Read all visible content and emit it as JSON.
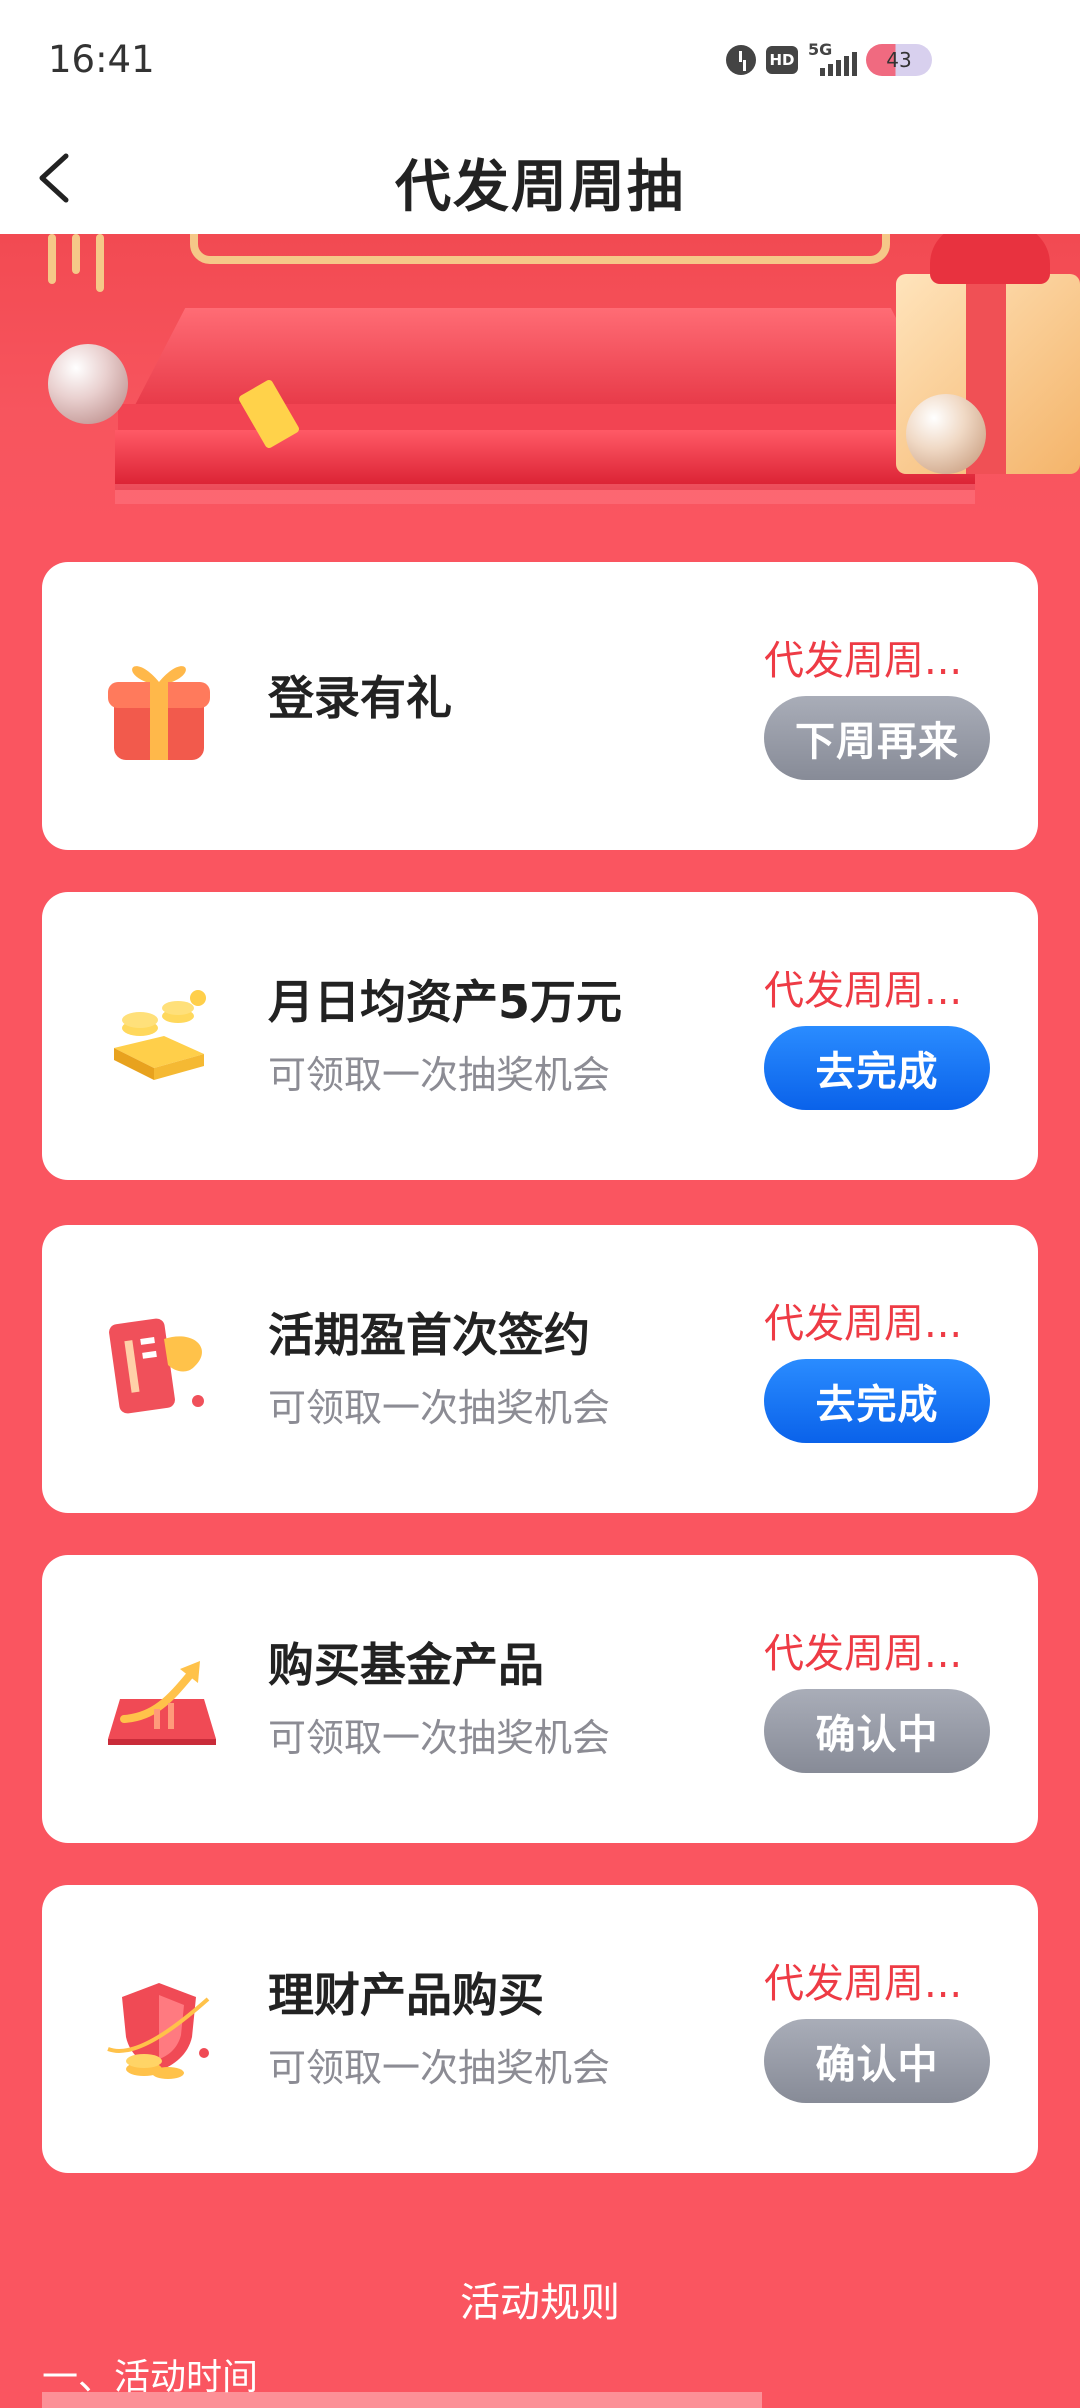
{
  "status_bar": {
    "time": "16:41",
    "hd_label": "HD",
    "network_label": "5G",
    "battery": "43",
    "icons": [
      "alarm-icon",
      "hd-icon",
      "5g-signal-icon",
      "battery-icon"
    ]
  },
  "header": {
    "title": "代发周周抽",
    "back_icon": "chevron-left-icon"
  },
  "tasks": [
    {
      "title": "登录有礼",
      "subtitle": "",
      "tag": "代发周周...",
      "button": "下周再来",
      "button_state": "disabled",
      "icon": "gift-box-icon"
    },
    {
      "title": "月日均资产5万元",
      "subtitle": "可领取一次抽奖机会",
      "tag": "代发周周...",
      "button": "去完成",
      "button_state": "active",
      "icon": "gold-bars-icon"
    },
    {
      "title": "活期盈首次签约",
      "subtitle": "可领取一次抽奖机会",
      "tag": "代发周周...",
      "button": "去完成",
      "button_state": "active",
      "icon": "contract-card-icon"
    },
    {
      "title": "购买基金产品",
      "subtitle": "可领取一次抽奖机会",
      "tag": "代发周周...",
      "button": "确认中",
      "button_state": "pending",
      "icon": "growth-arrow-icon"
    },
    {
      "title": "理财产品购买",
      "subtitle": "可领取一次抽奖机会",
      "tag": "代发周周...",
      "button": "确认中",
      "button_state": "pending",
      "icon": "shield-coins-icon"
    }
  ],
  "rules": {
    "title": "活动规则",
    "section_1": "一、活动时间"
  },
  "colors": {
    "page_background": "#fa5560",
    "tag_red": "#ee3b45",
    "button_blue": "#0a62ea",
    "button_gray": "#878b97"
  }
}
